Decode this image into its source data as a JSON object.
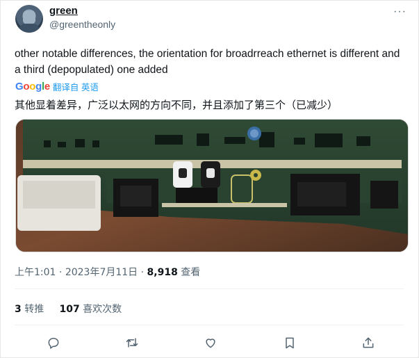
{
  "user": {
    "display_name": "green",
    "handle": "@greentheonly"
  },
  "tweet": {
    "text": "other notable differences, the orientation for broadrreach ethernet is different and a third (depopulated) one added",
    "translation": {
      "provider": "Google",
      "label": "翻译自 英语",
      "text": "其他显着差异，广泛以太网的方向不同，并且添加了第三个（已减少）"
    }
  },
  "meta": {
    "time": "上午1:01",
    "separator": "·",
    "date": "2023年7月11日",
    "views_count": "8,918",
    "views_label": "查看"
  },
  "stats": {
    "retweets_count": "3",
    "retweets_label": "转推",
    "likes_count": "107",
    "likes_label": "喜欢次数"
  },
  "icons": {
    "more": "more-options-icon",
    "reply": "reply-icon",
    "retweet": "retweet-icon",
    "like": "heart-icon",
    "bookmark": "bookmark-icon",
    "share": "share-icon"
  },
  "colors": {
    "text": "#0f1419",
    "secondary": "#536471",
    "link": "#1d9bf0",
    "divider": "#eff3f4"
  }
}
